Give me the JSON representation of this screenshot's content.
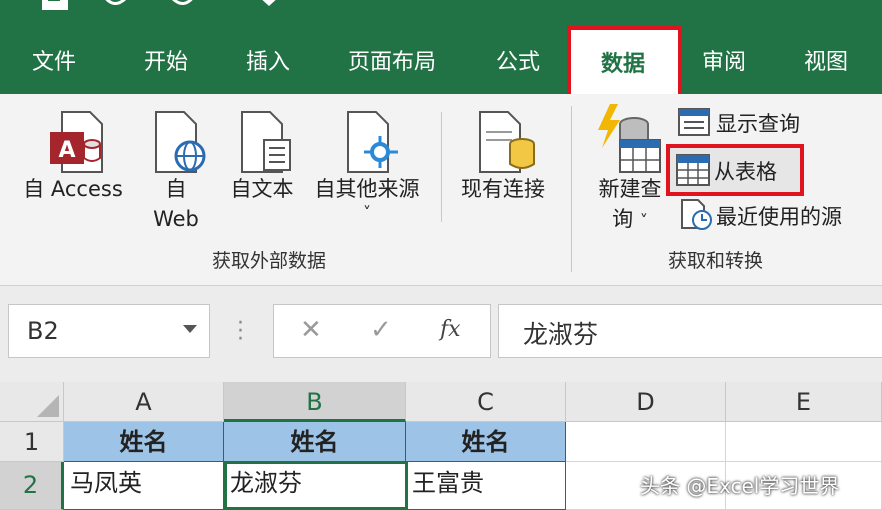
{
  "menu_tabs": [
    "文件",
    "开始",
    "插入",
    "页面布局",
    "公式",
    "数据",
    "审阅",
    "视图"
  ],
  "active_tab": "数据",
  "ribbon": {
    "get_external": {
      "buttons": [
        "自 Access",
        "自",
        "Web",
        "自文本",
        "自其他来源",
        "现有连接"
      ],
      "group_label": "获取外部数据"
    },
    "get_transform": {
      "new_query_line1": "新建查",
      "new_query_line2": "询",
      "show_queries": "显示查询",
      "from_table": "从表格",
      "recent_sources": "最近使用的源",
      "group_label": "获取和转换"
    },
    "dropdown_caret": "˅"
  },
  "formula_bar": {
    "name_box": "B2",
    "cancel": "✕",
    "enter": "✓",
    "fx": "fx",
    "value": "龙淑芬"
  },
  "sheet": {
    "columns": [
      "A",
      "B",
      "C",
      "D",
      "E"
    ],
    "rows": [
      "1",
      "2"
    ],
    "header_row": [
      "姓名",
      "姓名",
      "姓名"
    ],
    "data_row": [
      "马凤英",
      "龙淑芬",
      "王富贵"
    ]
  },
  "watermark": "头条 @Excel学习世界",
  "colors": {
    "excel_green": "#217346",
    "highlight_red": "#e0141e",
    "header_blue": "#9dc3e6"
  }
}
